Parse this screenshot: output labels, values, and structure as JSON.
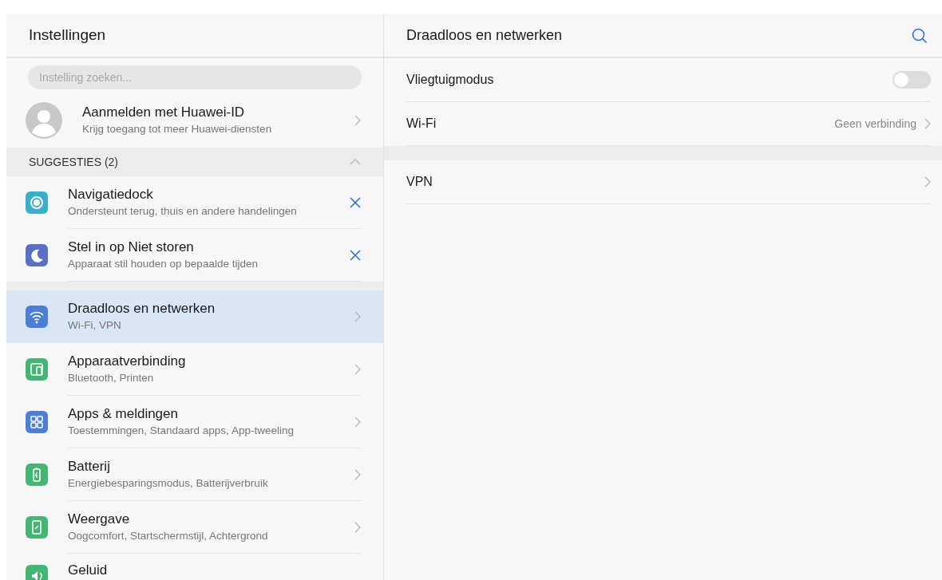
{
  "left": {
    "title": "Instellingen",
    "search": {
      "placeholder": "Instelling zoeken..."
    },
    "account": {
      "title": "Aanmelden met Huawei-ID",
      "subtitle": "Krijg toegang tot meer Huawei-diensten"
    },
    "suggestions": {
      "header": "SUGGESTIES (2)",
      "expanded": true,
      "items": [
        {
          "kind": "dock",
          "color": "#3aaecb",
          "title": "Navigatiedock",
          "subtitle": "Ondersteunt terug, thuis en andere handelingen"
        },
        {
          "kind": "moon",
          "color": "#5a6fc4",
          "title": "Stel in op Niet storen",
          "subtitle": "Apparaat stil houden op bepaalde tijden"
        }
      ]
    },
    "items": [
      {
        "kind": "wifi",
        "color": "#4a7fd4",
        "title": "Draadloos en netwerken",
        "subtitle": "Wi-Fi, VPN",
        "selected": true
      },
      {
        "kind": "devices",
        "color": "#45b573",
        "title": "Apparaatverbinding",
        "subtitle": "Bluetooth, Printen",
        "selected": false
      },
      {
        "kind": "apps",
        "color": "#4a7fd4",
        "title": "Apps & meldingen",
        "subtitle": "Toestemmingen, Standaard apps, App-tweeling",
        "selected": false
      },
      {
        "kind": "battery",
        "color": "#45b573",
        "title": "Batterij",
        "subtitle": "Energiebesparingsmodus, Batterijverbruik",
        "selected": false
      },
      {
        "kind": "display",
        "color": "#45b573",
        "title": "Weergave",
        "subtitle": "Oogcomfort, Startschermstijl, Achtergrond",
        "selected": false
      },
      {
        "kind": "sound",
        "color": "#45b573",
        "title": "Geluid",
        "selected": false
      }
    ]
  },
  "right": {
    "title": "Draadloos en netwerken",
    "groups": [
      [
        {
          "kind": "toggle",
          "label": "Vliegtuigmodus",
          "on": false
        },
        {
          "kind": "link",
          "label": "Wi-Fi",
          "value": "Geen verbinding"
        }
      ],
      [
        {
          "kind": "link",
          "label": "VPN"
        }
      ]
    ]
  }
}
